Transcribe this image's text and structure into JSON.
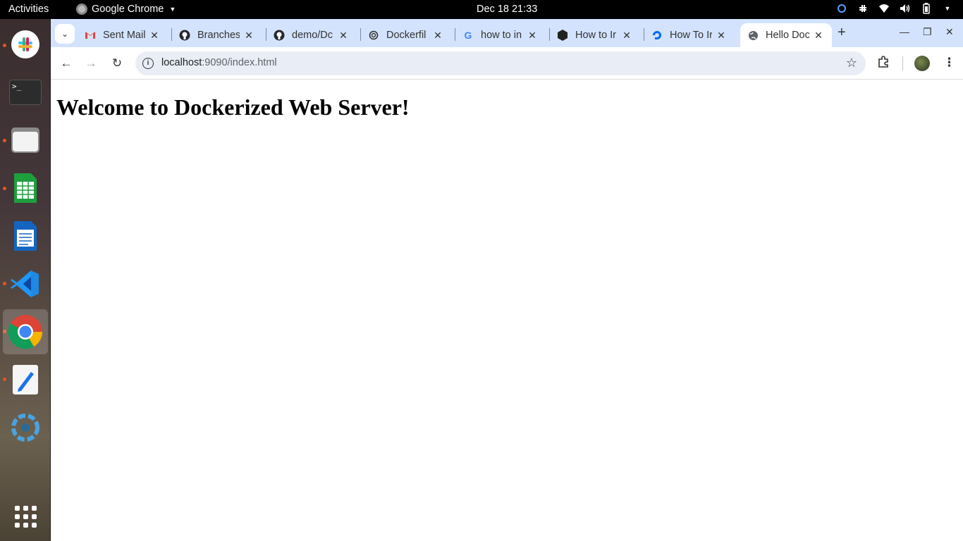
{
  "topbar": {
    "activities": "Activities",
    "app_name": "Google Chrome",
    "clock": "Dec 18  21:33",
    "tray_icons": [
      "sync-icon",
      "slack-tray-icon",
      "wifi-icon",
      "volume-icon",
      "battery-icon",
      "system-menu-caret-icon"
    ]
  },
  "dock": {
    "items": [
      "slack",
      "terminal",
      "files",
      "libreoffice-calc",
      "libreoffice-writer",
      "vscode",
      "google-chrome",
      "text-editor",
      "shotwell",
      "show-applications"
    ],
    "terminal_glyph": ">_"
  },
  "browser": {
    "tabs": [
      {
        "title": "Sent Mail",
        "favicon": "gmail-icon",
        "favicon_color": "#ea4335"
      },
      {
        "title": "Branches",
        "favicon": "github-icon",
        "favicon_color": "#24292f"
      },
      {
        "title": "demo/Dc",
        "favicon": "github-icon",
        "favicon_color": "#24292f"
      },
      {
        "title": "Dockerfil",
        "favicon": "openai-icon",
        "favicon_color": "#333333"
      },
      {
        "title": "how to in",
        "favicon": "google-icon",
        "favicon_color": "#4285f4"
      },
      {
        "title": "How to Ir",
        "favicon": "hexagon-icon",
        "favicon_color": "#222222"
      },
      {
        "title": "How To Ir",
        "favicon": "digitalocean-icon",
        "favicon_color": "#0069ff"
      },
      {
        "title": "Hello Doc",
        "favicon": "globe-icon",
        "favicon_color": "#5f6368",
        "active": true
      }
    ],
    "new_tab_glyph": "+",
    "url_host": "localhost",
    "url_rest": ":9090/index.html"
  },
  "page": {
    "heading": "Welcome to Dockerized Web Server!"
  },
  "colors": {
    "tabstrip_bg": "#d3e3fd",
    "omnibox_bg": "#e9eef6",
    "dock_dot": "#e95420"
  }
}
